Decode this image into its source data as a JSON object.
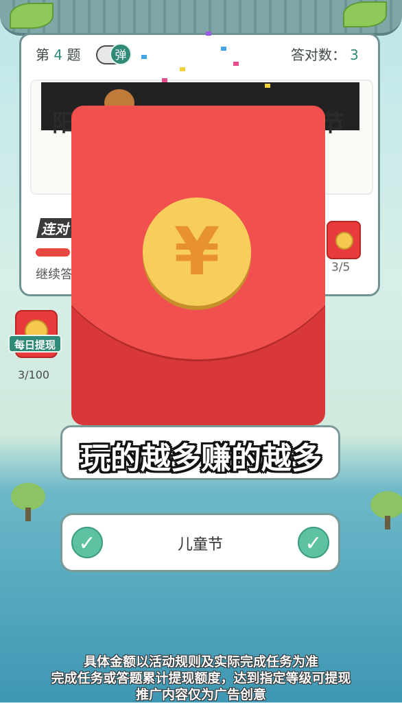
{
  "header": {
    "question_prefix": "第",
    "question_number": "4",
    "question_suffix": "题",
    "danmaku_toggle_label": "弹",
    "score_label": "答对数：",
    "score_value": "3"
  },
  "question": {
    "text_start": "阳",
    "text_end": "节"
  },
  "streak": {
    "label": "连对",
    "continue_text": "继续答",
    "reward_progress": "3/5"
  },
  "daily_withdraw": {
    "label": "每日提现",
    "progress": "3/100"
  },
  "envelope": {
    "currency_symbol": "¥"
  },
  "banner": {
    "text": "玩的越多赚的越多"
  },
  "answer_option": {
    "label": "儿童节"
  },
  "disclaimer": {
    "line1": "具体金额以活动规则及实际完成任务为准",
    "line2": "完成任务或答题累计提现额度，达到指定等级可提现",
    "line3": "推广内容仅为广告创意"
  },
  "colors": {
    "accent_green": "#2f8a78",
    "envelope_red": "#d9383a",
    "coin_gold": "#f7cd5c"
  }
}
